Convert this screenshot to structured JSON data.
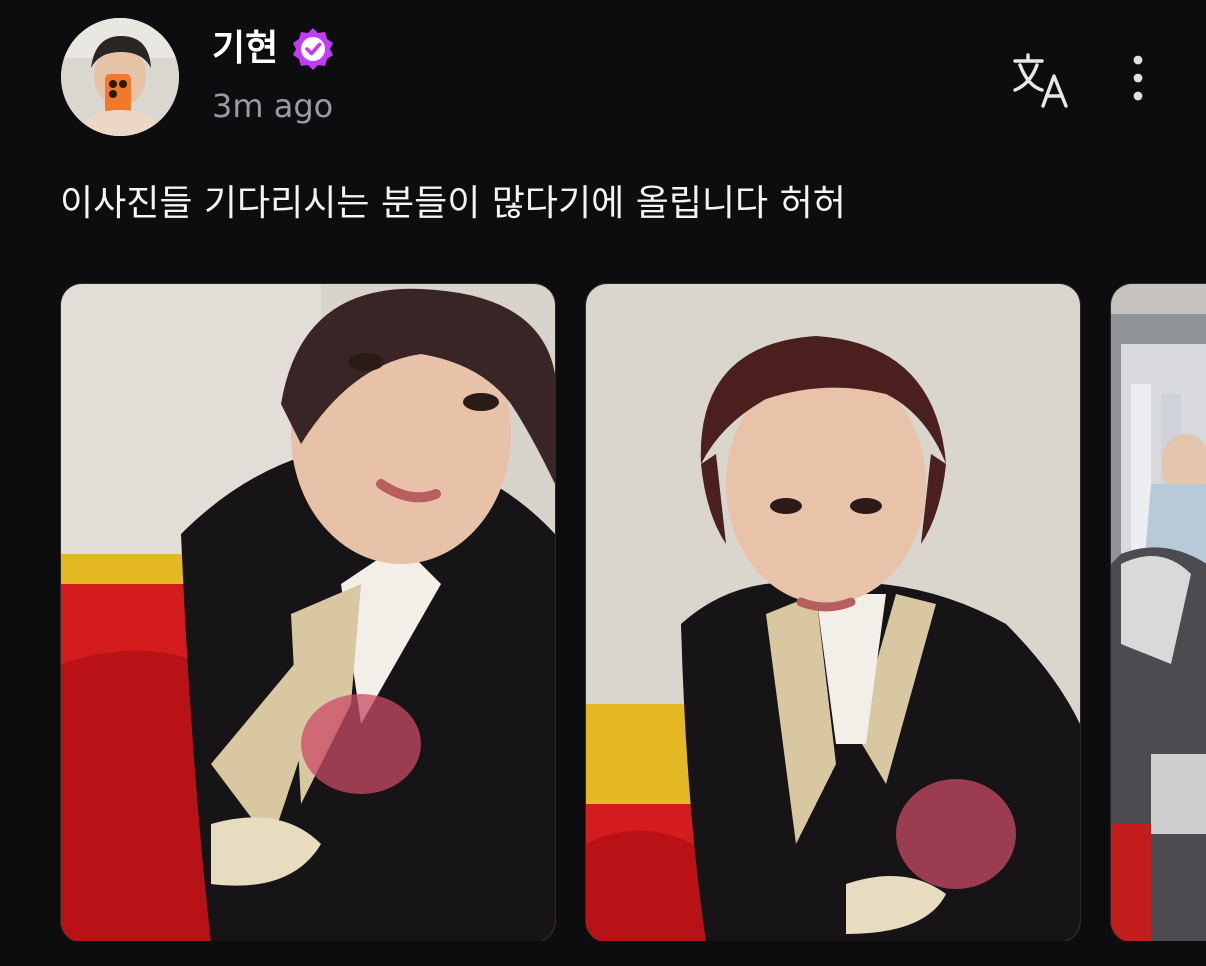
{
  "post": {
    "author": {
      "name": "기현",
      "verified": true,
      "avatar": "profile-photo"
    },
    "timestamp": "3m ago",
    "text": "이사진들 기다리시는 분들이 많다기에 올립니다 허허",
    "actions": {
      "translate_icon": "translate-icon",
      "more_icon": "more-vertical-icon"
    },
    "photos": [
      {
        "alt": "selfie in hanbok, head tilted"
      },
      {
        "alt": "selfie in hanbok, facing camera"
      },
      {
        "alt": "backstage photo, partially visible"
      }
    ]
  },
  "colors": {
    "background": "#0d0d0f",
    "verified_badge": "#c23bf5",
    "muted_text": "#9a9aa0"
  }
}
